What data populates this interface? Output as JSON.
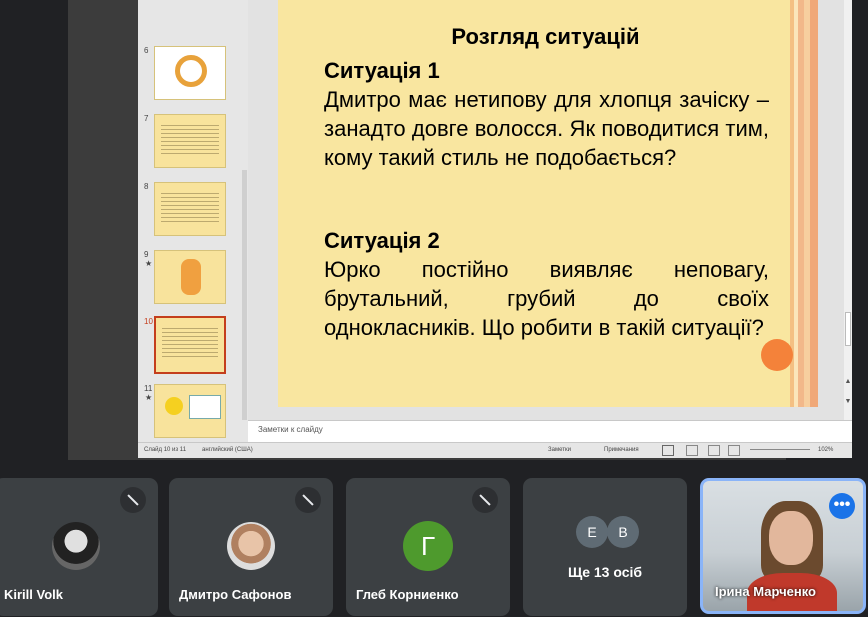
{
  "thumbnails": [
    {
      "num": "6",
      "star": ""
    },
    {
      "num": "7",
      "star": ""
    },
    {
      "num": "8",
      "star": ""
    },
    {
      "num": "9",
      "star": "★"
    },
    {
      "num": "10",
      "star": ""
    },
    {
      "num": "11",
      "star": "★"
    }
  ],
  "slide": {
    "title": "Розгляд ситуацій",
    "situation1_heading": "Ситуація 1",
    "situation1_text": "Дмитро має нетипову для хлопця зачіску – занадто довге волосся. Як поводитися тим, кому такий стиль  не подобається?",
    "situation2_heading": "Ситуація 2",
    "situation2_text": "Юрко постійно виявляє неповагу, брутальний, грубий до своїх однокласників. Що робити в такій ситуації?"
  },
  "notes_placeholder": "Заметки к слайду",
  "statusbar": {
    "slide_counter": "Слайд 10 из 11",
    "language": "английский (США)",
    "notes_btn": "Заметки",
    "comments_btn": "Примечания",
    "zoom": "102%"
  },
  "participants": [
    {
      "name": "Kirill Volk"
    },
    {
      "name": "Дмитро Сафонов"
    },
    {
      "name": "Глеб Корниенко",
      "initial": "Г"
    }
  ],
  "more_tile": {
    "avatars": [
      "E",
      "B"
    ],
    "label": "Ще 13 осіб"
  },
  "self_tile": {
    "name": "Ірина Марченко",
    "menu_icon": "•••"
  },
  "colors": {
    "slide_bg": "#f9e6a0",
    "accent_dot": "#f4823a",
    "meet_bg": "#202124",
    "active_border": "#8ab4f8"
  }
}
